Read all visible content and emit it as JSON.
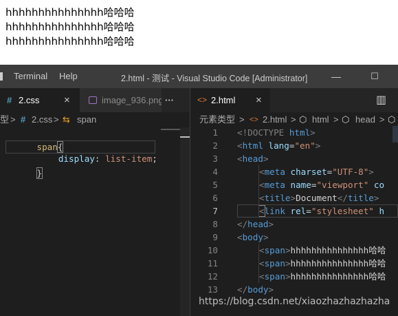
{
  "browser": {
    "lines": [
      "hhhhhhhhhhhhhhh哈哈哈",
      "hhhhhhhhhhhhhhh哈哈哈",
      "hhhhhhhhhhhhhhh哈哈哈"
    ]
  },
  "titlebar": {
    "menu_terminal": "Terminal",
    "menu_help": "Help",
    "window_title": "2.html - 测试 - Visual Studio Code [Administrator]",
    "minimize": "—",
    "maximize": "☐"
  },
  "left_editor": {
    "tabs": [
      {
        "icon": "#",
        "label": "2.css",
        "close": "×"
      },
      {
        "label": "image_936.png"
      }
    ],
    "more_label": "···",
    "breadcrumb": {
      "prefix": "型",
      "sep1": ">",
      "file_icon": "#",
      "file": "2.css",
      "sep2": ">",
      "symbol_icon": "⇆",
      "symbol": "span"
    },
    "code": {
      "line1_selector": "span",
      "line1_brace": "{",
      "line2_prop": "display",
      "line2_colon": ": ",
      "line2_value": "list-item",
      "line2_semi": ";",
      "line3_brace": "}"
    }
  },
  "right_editor": {
    "tab": {
      "icon": "<>",
      "label": "2.html",
      "close": "×"
    },
    "split_icon": "▥",
    "breadcrumb": {
      "root": "元素类型",
      "sep": ">",
      "file": "2.html",
      "html": "html",
      "head": "head"
    },
    "line_numbers": [
      "1",
      "2",
      "3",
      "4",
      "5",
      "6",
      "7",
      "8",
      "9",
      "10",
      "11",
      "12",
      "13"
    ],
    "lines": {
      "l1_doctype": "<!DOCTYPE",
      "l1_html": " html",
      "l1_close": ">",
      "l2_open": "<",
      "l2_tag": "html",
      "l2_attr": " lang",
      "l2_eq": "=",
      "l2_val": "\"en\"",
      "l2_close": ">",
      "l3_open": "<",
      "l3_tag": "head",
      "l3_close": ">",
      "l4_open": "<",
      "l4_tag": "meta",
      "l4_attr": " charset",
      "l4_eq": "=",
      "l4_val": "\"UTF-8\"",
      "l4_close": ">",
      "l5_open": "<",
      "l5_tag": "meta",
      "l5_attr": " name",
      "l5_eq": "=",
      "l5_val": "\"viewport\"",
      "l5_rest": " co",
      "l6_open": "<",
      "l6_tag": "title",
      "l6_gt": ">",
      "l6_text": "Document",
      "l6_close_open": "</",
      "l6_close_tag": "title",
      "l6_close_gt": ">",
      "l7_open": "<",
      "l7_tag": "link",
      "l7_attr": " rel",
      "l7_eq": "=",
      "l7_val": "\"stylesheet\"",
      "l7_rest": " h",
      "l8_open": "</",
      "l8_tag": "head",
      "l8_close": ">",
      "l9_open": "<",
      "l9_tag": "body",
      "l9_close": ">",
      "span_open": "<",
      "span_tag": "span",
      "span_gt": ">",
      "span_text": "hhhhhhhhhhhhhhh哈哈",
      "l13_open": "</",
      "l13_tag": "body",
      "l13_close": ">"
    }
  },
  "watermark": "https://blog.csdn.net/xiaozhazhazhazha",
  "colors": {
    "editor_bg": "#1e1e1e",
    "titlebar_bg": "#3c3c3c",
    "tabbar_bg": "#252526",
    "tag": "#569cd6",
    "attr": "#9cdcfe",
    "string": "#ce9178",
    "selector": "#d7ba7d",
    "css_icon": "#519aba",
    "html_icon": "#e37933"
  }
}
